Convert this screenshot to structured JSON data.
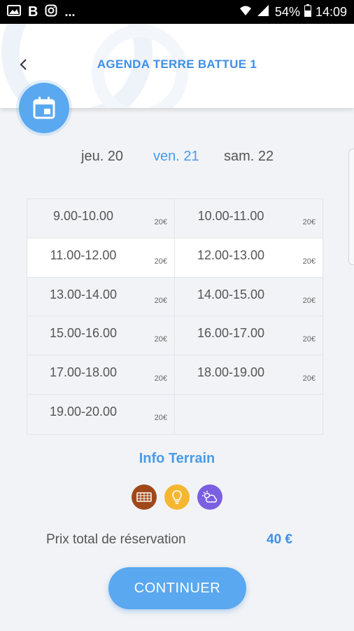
{
  "status_bar": {
    "battery_pct": "54%",
    "time": "14:09",
    "notif_more": "...",
    "icons": [
      "image-icon",
      "b-icon",
      "instagram-icon",
      "wifi-icon",
      "signal-icon",
      "battery-icon"
    ]
  },
  "header": {
    "title": "AGENDA TERRE BATTUE 1",
    "back_icon": "chevron-left-icon",
    "calendar_icon": "calendar-icon"
  },
  "days": [
    {
      "label": "jeu. 20",
      "active": false
    },
    {
      "label": "ven. 21",
      "active": true
    },
    {
      "label": "sam. 22",
      "active": false
    }
  ],
  "slots": [
    {
      "time": "9.00-10.00",
      "price": "20€"
    },
    {
      "time": "10.00-11.00",
      "price": "20€"
    },
    {
      "time": "11.00-12.00",
      "price": "20€",
      "selected": true
    },
    {
      "time": "12.00-13.00",
      "price": "20€",
      "selected": true
    },
    {
      "time": "13.00-14.00",
      "price": "20€"
    },
    {
      "time": "14.00-15.00",
      "price": "20€"
    },
    {
      "time": "15.00-16.00",
      "price": "20€"
    },
    {
      "time": "16.00-17.00",
      "price": "20€"
    },
    {
      "time": "17.00-18.00",
      "price": "20€"
    },
    {
      "time": "18.00-19.00",
      "price": "20€"
    },
    {
      "time": "19.00-20.00",
      "price": "20€"
    }
  ],
  "info": {
    "title": "Info Terrain",
    "icons": [
      {
        "name": "fence-icon",
        "color": "#a0481a"
      },
      {
        "name": "lightbulb-icon",
        "color": "#f5b731"
      },
      {
        "name": "weather-icon",
        "color": "#7a5fe0"
      }
    ]
  },
  "total": {
    "label": "Prix total de réservation",
    "value": "40 €"
  },
  "actions": {
    "continue_label": "CONTINUER"
  },
  "colors": {
    "accent": "#3d8fe8",
    "button": "#5aa8ef",
    "background": "#f1f3f6"
  }
}
